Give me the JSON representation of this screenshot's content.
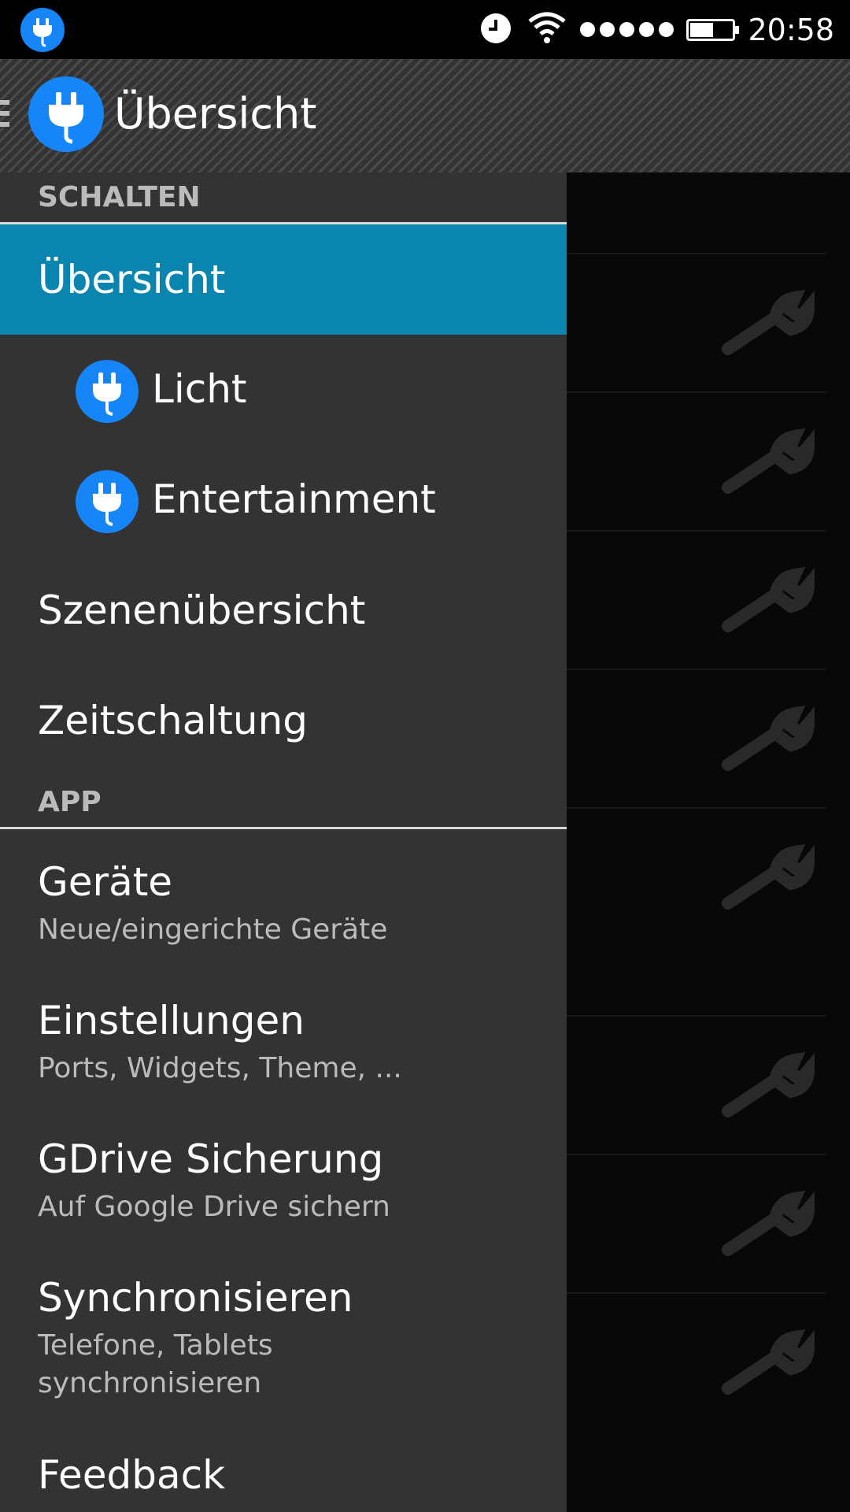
{
  "status_bar": {
    "time": "20:58",
    "battery_level": 0.55,
    "signal_dots": 5,
    "icons": [
      "plug-icon",
      "alarm-clock-icon",
      "wifi-icon",
      "signal-icon",
      "battery-icon"
    ]
  },
  "action_bar": {
    "title": "Übersicht",
    "icons": [
      "menu-icon",
      "plug-icon"
    ]
  },
  "drawer": {
    "section_schalten": "SCHALTEN",
    "items_schalten": [
      {
        "label": "Übersicht",
        "selected": true
      },
      {
        "label": "Licht",
        "icon": "plug-icon"
      },
      {
        "label": "Entertainment",
        "icon": "plug-icon"
      },
      {
        "label": "Szenenübersicht"
      },
      {
        "label": "Zeitschaltung"
      }
    ],
    "section_app": "APP",
    "items_app": [
      {
        "label": "Geräte",
        "sub": "Neue/eingerichte Geräte"
      },
      {
        "label": "Einstellungen",
        "sub": "Ports, Widgets, Theme, ..."
      },
      {
        "label": "GDrive Sicherung",
        "sub": "Auf Google Drive sichern"
      },
      {
        "label": "Synchronisieren",
        "sub_line1": "Telefone, Tablets",
        "sub_line2": "synchronisieren"
      },
      {
        "label": "Feedback"
      }
    ]
  },
  "background_list": {
    "row_icon": "wrench-icon",
    "row_count": 8
  },
  "colors": {
    "accent": "#1685f7",
    "selected": "#0a85b0",
    "drawer_bg": "#333333"
  }
}
